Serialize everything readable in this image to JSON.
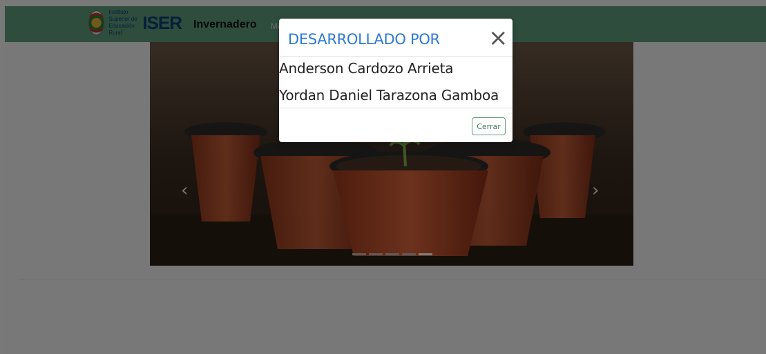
{
  "navbar": {
    "logo_line1": "Instituto Superior de",
    "logo_line2": "Educación Rural",
    "logo_mark": "ISER",
    "brand": "Invernadero",
    "menu_partial": "Me"
  },
  "carousel": {
    "prev_icon": "chevron-left-icon",
    "next_icon": "chevron-right-icon",
    "indicators": 5,
    "active_index": 4
  },
  "modal": {
    "title": "DESARROLLADO POR",
    "close_icon": "×",
    "developers": [
      "Anderson Cardozo Arrieta",
      "Yordan Daniel Tarazona Gamboa"
    ],
    "button_label": "Cerrar"
  },
  "colors": {
    "navbar": "#5c9a7a",
    "title": "#2d79d6",
    "button_border": "#5c9a7a"
  }
}
